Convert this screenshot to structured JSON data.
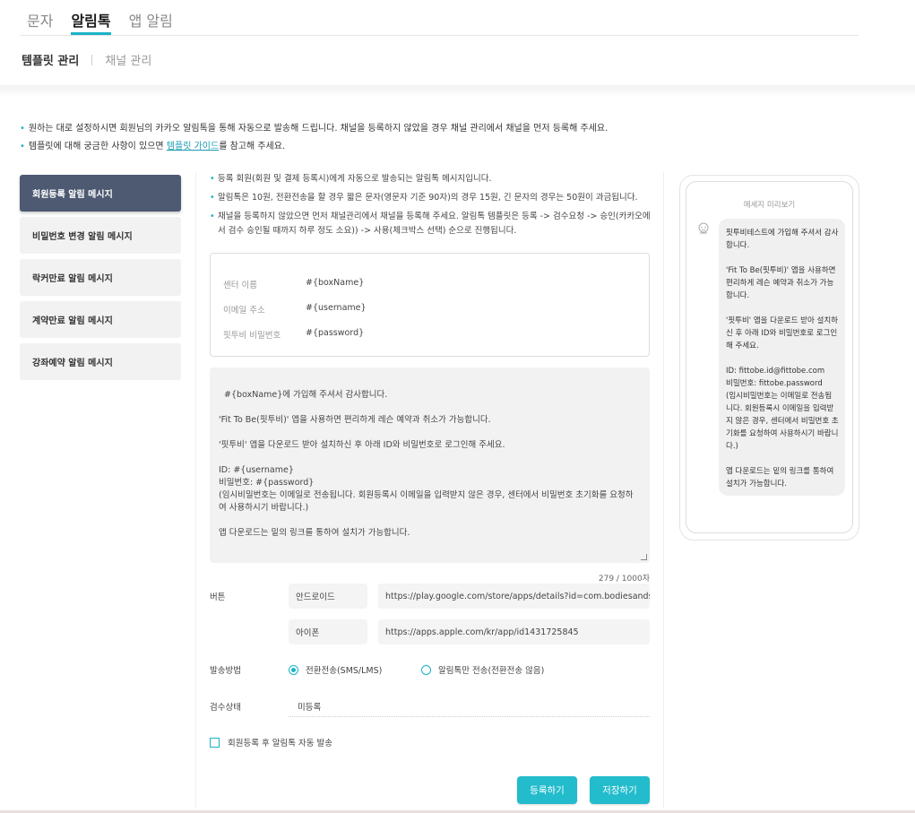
{
  "header": {
    "tabs": [
      {
        "label": "문자",
        "active": false
      },
      {
        "label": "알림톡",
        "active": true
      },
      {
        "label": "앱 알림",
        "active": false
      }
    ],
    "subtabs": [
      {
        "label": "템플릿 관리",
        "active": true
      },
      {
        "label": "채널 관리",
        "active": false
      }
    ]
  },
  "notices": {
    "line1": "원하는 대로 설정하시면 회원님의 카카오 알림톡을 통해 자동으로 발송해 드립니다. 채널을 등록하지 않았을 경우 채널 관리에서 채널을 먼저 등록해 주세요.",
    "line2_before": "템플릿에 대해 궁금한 사항이 있으면 ",
    "line2_link": "템플릿 가이드",
    "line2_after": "를 참고해 주세요."
  },
  "sidebar": {
    "items": [
      {
        "label": "회원등록 알림 메시지",
        "active": true
      },
      {
        "label": "비밀번호 변경 알림 메시지",
        "active": false
      },
      {
        "label": "락커만료 알림 메시지",
        "active": false
      },
      {
        "label": "계약만료 알림 메시지",
        "active": false
      },
      {
        "label": "강좌예약 알림 메시지",
        "active": false
      }
    ]
  },
  "info_bullets": [
    "등록 회원(회원 및 결제 등록시)에게 자동으로 발송되는 알림톡 메시지입니다.",
    "알림톡은 10원, 전환전송을 할 경우 짧은 문자(영문자 기준 90자)의 경우 15원, 긴 문자의 경우는 50원이 과금됩니다.",
    "채널을 등록하지 않았으면 먼저 채널관리에서 채널을 등록해 주세요. 알림톡 템플릿은 등록 -> 검수요청 -> 승인(카카오에서 검수 승인될 때까지 하루 정도 소요)) -> 사용(체크박스 선택) 순으로 진행됩니다."
  ],
  "variables": [
    {
      "label": "센터 이름",
      "value": "#{boxName}"
    },
    {
      "label": "이메일 주소",
      "value": "#{username}"
    },
    {
      "label": "핏투비 비밀번호",
      "value": "#{password}"
    }
  ],
  "message": {
    "text": "#{boxName}에 가입해 주셔서 감사합니다.\n\n'Fit To Be(핏투비)' 앱을 사용하면 편리하게 레슨 예약과 취소가 가능합니다.\n\n'핏투비' 앱을 다운로드 받아 설치하신 후 아래 ID와 비밀번호로 로그인해 주세요.\n\nID: #{username}\n비밀번호: #{password}\n(임시비밀번호는 이메일로 전송됩니다. 회원등록시 이메일을 입력받지 않은 경우, 센터에서 비밀번호 초기화를 요청하여 사용하시기 바랍니다.)\n\n앱 다운로드는 밑의 링크를 통하여 설치가 가능합니다.",
    "counter": "279 / 1000자"
  },
  "buttons_section": {
    "label": "버튼",
    "android_label": "안드로이드",
    "android_url": "https://play.google.com/store/apps/details?id=com.bodiesandsou",
    "ios_label": "아이폰",
    "ios_url": "https://apps.apple.com/kr/app/id1431725845"
  },
  "send_method": {
    "label": "발송방법",
    "options": [
      {
        "label": "전환전송(SMS/LMS)",
        "selected": true
      },
      {
        "label": "알림톡만 전송(전환전송 않음)",
        "selected": false
      }
    ]
  },
  "review_status": {
    "label": "검수상태",
    "value": "미등록"
  },
  "auto_send": {
    "label": "회원등록 후 알림톡 자동 발송",
    "checked": false
  },
  "actions": {
    "register": "등록하기",
    "save": "저장하기"
  },
  "preview": {
    "title": "메세지 미리보기",
    "icon": "chatbot-icon",
    "text": "핏투비테스트에 가입해 주셔서 감사합니다.\n\n'Fit To Be(핏투비)' 앱을 사용하면 편리하게 레슨 예약과 취소가 가능합니다.\n\n'핏투비' 앱을 다운로드 받아 설치하신 후 아래 ID와 비밀번호로 로그인해 주세요.\n\nID: fittobe.id@fittobe.com\n비밀번호: fittobe.password\n(임시비밀번호는 이메일로 전송됩니다. 회원등록시 이메일을 입력받지 않은 경우, 센터에서 비밀번호 초기화를 요청하여 사용하시기 바랍니다.)\n\n앱 다운로드는 밑의 링크를 통하여 설치가 가능합니다."
  },
  "colors": {
    "accent": "#1ab3c7",
    "sidebar_active": "#4e5a72",
    "button": "#22bccc"
  }
}
